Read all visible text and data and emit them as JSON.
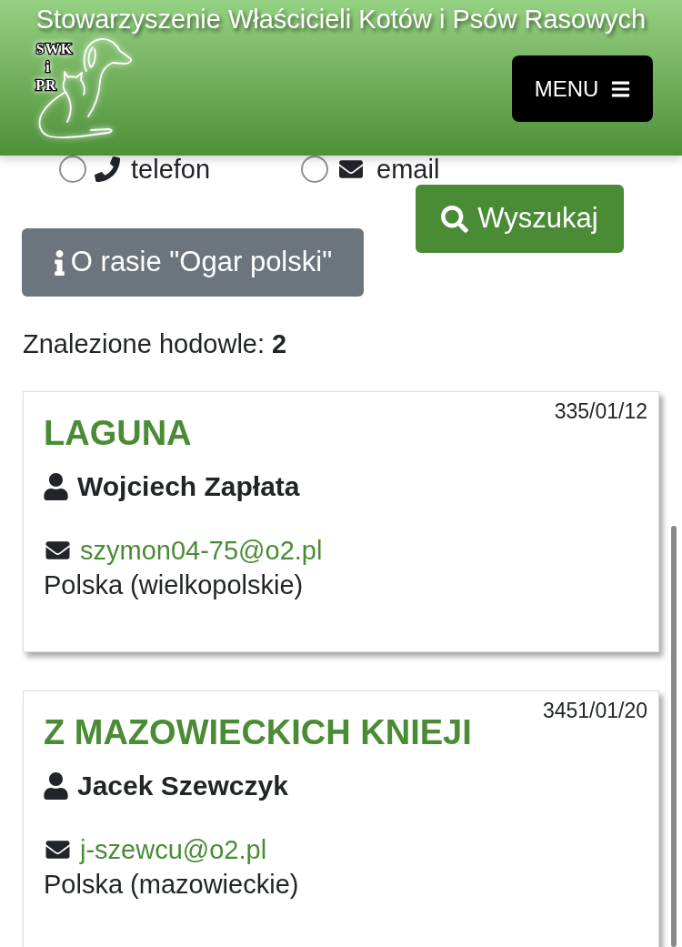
{
  "header": {
    "title": "Stowarzyszenie Właścicieli Kotów i Psów Rasowych",
    "logo": {
      "lines": [
        "SWK",
        "i",
        "PR"
      ]
    },
    "menu_button": {
      "label": "MENU"
    }
  },
  "contact_filter": {
    "options": [
      {
        "kind": "phone",
        "label": "telefon",
        "selected": false
      },
      {
        "kind": "email",
        "label": "email",
        "selected": false
      }
    ]
  },
  "search_button": {
    "label": "Wyszukaj"
  },
  "breed_button": {
    "label": "O rasie \"Ogar polski\""
  },
  "results": {
    "summary": "Znalezione hodowle: **2**"
  },
  "kennels": [
    {
      "number": "335/01/12",
      "name": "LAGUNA",
      "owner": "Wojciech Zapłata",
      "email": "szymon04-75@o2.pl",
      "location": "Polska (wielkopolskie)"
    },
    {
      "number": "3451/01/20",
      "name": "Z MAZOWIECKICH KNIEJI",
      "owner": "Jacek Szewczyk",
      "email": "j-szewcu@o2.pl",
      "location": "Polska (mazowieckie)"
    }
  ]
}
